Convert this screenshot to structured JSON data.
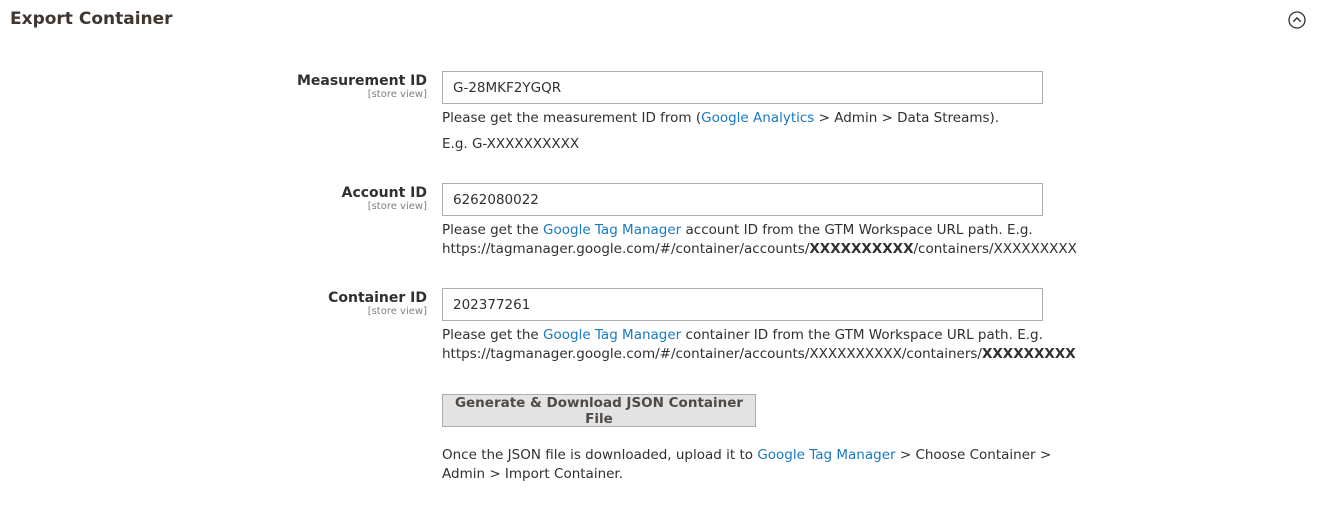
{
  "section": {
    "title": "Export Container",
    "collapse_icon": "chevron-up-circle-icon"
  },
  "fields": {
    "measurement": {
      "label": "Measurement ID",
      "scope": "[store view]",
      "value": "G-28MKF2YGQR",
      "note1_pre": "Please get the measurement ID from (",
      "note1_link": "Google Analytics",
      "note1_post": " > Admin > Data Streams).",
      "note2": "E.g. G-XXXXXXXXXX"
    },
    "account": {
      "label": "Account ID",
      "scope": "[store view]",
      "value": "6262080022",
      "note_pre": "Please get the ",
      "note_link": "Google Tag Manager",
      "note_post": " account ID from the GTM Workspace URL path. E.g.",
      "url_pre": "https://tagmanager.google.com/#/container/accounts/",
      "url_bold": "XXXXXXXXXX",
      "url_post": "/containers/XXXXXXXXX"
    },
    "container": {
      "label": "Container ID",
      "scope": "[store view]",
      "value": "202377261",
      "note_pre": "Please get the ",
      "note_link": "Google Tag Manager",
      "note_post": " container ID from the GTM Workspace URL path. E.g.",
      "url_pre": "https://tagmanager.google.com/#/container/accounts/XXXXXXXXXX/containers/",
      "url_bold": "XXXXXXXXX"
    }
  },
  "action": {
    "button_label": "Generate & Download JSON Container File",
    "note_pre": "Once the JSON file is downloaded, upload it to ",
    "note_link": "Google Tag Manager",
    "note_mid": " > Choose Container >",
    "note_line2": "Admin > Import Container."
  },
  "colors": {
    "link": "#1979c3",
    "button_bg": "#e3e3e3",
    "border": "#adadad"
  }
}
